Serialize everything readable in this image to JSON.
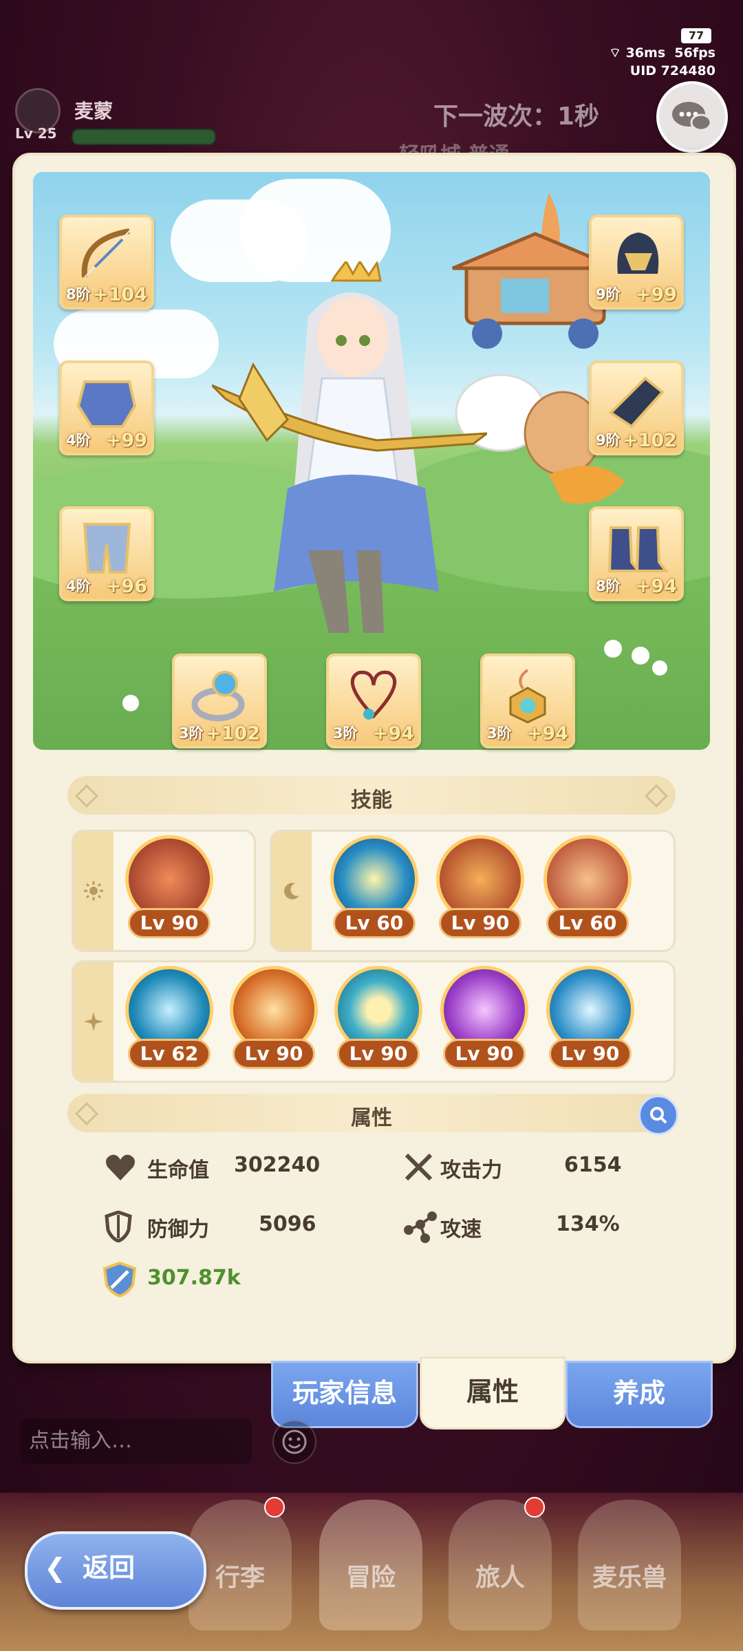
{
  "status": {
    "battery": "77",
    "ping": "36ms",
    "fps": "56fps",
    "uid": "UID 724480"
  },
  "background": {
    "player_name": "麦蒙",
    "player_level": "Lv 25",
    "wave_text": "下一波次：1秒",
    "sub_text": "轻吼城 普通"
  },
  "equipment": [
    {
      "name": "bow",
      "tier": "8阶",
      "plus": "+104"
    },
    {
      "name": "helmet",
      "tier": "9阶",
      "plus": "+99"
    },
    {
      "name": "chest-armor",
      "tier": "4阶",
      "plus": "+99"
    },
    {
      "name": "gauntlet",
      "tier": "9阶",
      "plus": "+102"
    },
    {
      "name": "leg-armor",
      "tier": "4阶",
      "plus": "+96"
    },
    {
      "name": "boots",
      "tier": "8阶",
      "plus": "+94"
    },
    {
      "name": "ring",
      "tier": "3阶",
      "plus": "+102"
    },
    {
      "name": "necklace",
      "tier": "3阶",
      "plus": "+94"
    },
    {
      "name": "amulet",
      "tier": "3阶",
      "plus": "+94"
    }
  ],
  "skills": {
    "title": "技能",
    "sun": [
      {
        "level": "Lv 90"
      }
    ],
    "moon": [
      {
        "level": "Lv 60"
      },
      {
        "level": "Lv 90"
      },
      {
        "level": "Lv 60"
      }
    ],
    "star": [
      {
        "level": "Lv 62"
      },
      {
        "level": "Lv 90"
      },
      {
        "level": "Lv 90"
      },
      {
        "level": "Lv 90"
      },
      {
        "level": "Lv 90"
      }
    ]
  },
  "attributes": {
    "title": "属性",
    "hp_label": "生命值",
    "hp_value": "302240",
    "atk_label": "攻击力",
    "atk_value": "6154",
    "def_label": "防御力",
    "def_value": "5096",
    "spd_label": "攻速",
    "spd_value": "134%",
    "power_value": "307.87k"
  },
  "tabs": {
    "player_info": "玩家信息",
    "attributes": "属性",
    "develop": "养成"
  },
  "chat": {
    "placeholder": "点击输入…"
  },
  "nav": {
    "back": "返回",
    "items": [
      "行李",
      "冒险",
      "旅人",
      "麦乐兽"
    ]
  },
  "colors": {
    "accent_gold": "#f4d58f",
    "tab_blue": "#5d86db",
    "level_badge": "#b1521c",
    "power_green": "#4f8f2f"
  }
}
